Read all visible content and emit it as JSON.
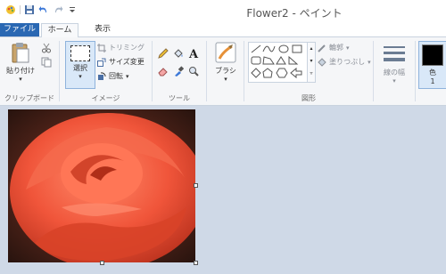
{
  "window": {
    "title": "Flower2 - ペイント"
  },
  "tabs": {
    "file": "ファイル",
    "home": "ホーム",
    "view": "表示"
  },
  "clipboard": {
    "paste": "貼り付け",
    "group": "クリップボード"
  },
  "image": {
    "select": "選択",
    "crop": "トリミング",
    "resize": "サイズ変更",
    "rotate": "回転",
    "group": "イメージ"
  },
  "tools": {
    "group": "ツール"
  },
  "brushes": {
    "label": "ブラシ"
  },
  "shapes": {
    "group": "図形",
    "outline": "輪郭",
    "fill": "塗りつぶし"
  },
  "size": {
    "label": "線の幅"
  },
  "color": {
    "label": "色",
    "index": "1"
  },
  "colors": {
    "tab_blue": "#2a68b3",
    "accent_light": "#d9e8f8"
  }
}
